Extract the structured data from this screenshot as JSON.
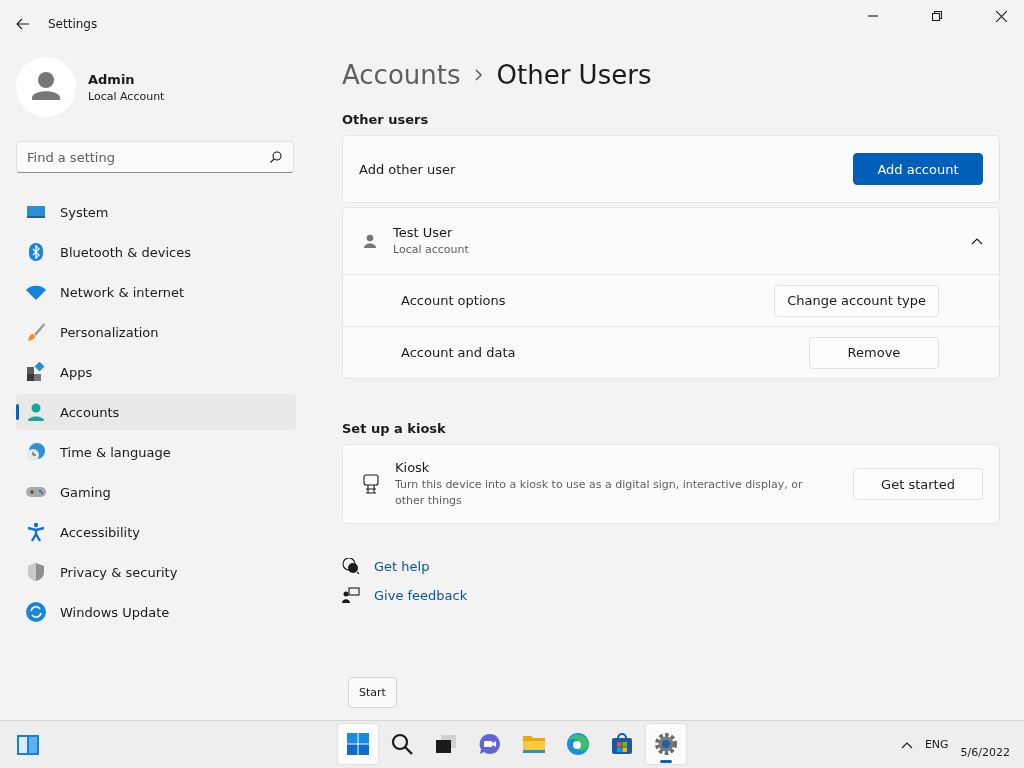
{
  "window": {
    "title": "Settings"
  },
  "profile": {
    "name": "Admin",
    "subtitle": "Local Account"
  },
  "search": {
    "placeholder": "Find a setting"
  },
  "sidebar": {
    "items": [
      {
        "kind": "system",
        "label": "System",
        "selected": false
      },
      {
        "kind": "bluetooth",
        "label": "Bluetooth & devices",
        "selected": false
      },
      {
        "kind": "network",
        "label": "Network & internet",
        "selected": false
      },
      {
        "kind": "personalization",
        "label": "Personalization",
        "selected": false
      },
      {
        "kind": "apps",
        "label": "Apps",
        "selected": false
      },
      {
        "kind": "accounts",
        "label": "Accounts",
        "selected": true
      },
      {
        "kind": "time",
        "label": "Time & language",
        "selected": false
      },
      {
        "kind": "gaming",
        "label": "Gaming",
        "selected": false
      },
      {
        "kind": "accessibility",
        "label": "Accessibility",
        "selected": false
      },
      {
        "kind": "privacy",
        "label": "Privacy & security",
        "selected": false
      },
      {
        "kind": "update",
        "label": "Windows Update",
        "selected": false
      }
    ]
  },
  "breadcrumb": {
    "parent": "Accounts",
    "current": "Other Users"
  },
  "other_users": {
    "heading": "Other users",
    "add_row": {
      "label": "Add other user",
      "button": "Add account"
    },
    "users": [
      {
        "name": "Test User",
        "subtitle": "Local account",
        "expanded": true,
        "options": [
          {
            "label": "Account options",
            "button": "Change account type"
          },
          {
            "label": "Account and data",
            "button": "Remove"
          }
        ]
      }
    ]
  },
  "kiosk": {
    "heading": "Set up a kiosk",
    "title": "Kiosk",
    "description": "Turn this device into a kiosk to use as a digital sign, interactive display, or other things",
    "button": "Get started"
  },
  "links": [
    {
      "kind": "help",
      "label": "Get help"
    },
    {
      "kind": "feedback",
      "label": "Give feedback"
    }
  ],
  "tooltip": {
    "text": "Start"
  },
  "taskbar": {
    "apps": [
      {
        "kind": "start",
        "hovered": true,
        "active": false
      },
      {
        "kind": "search",
        "hovered": false,
        "active": false
      },
      {
        "kind": "taskview",
        "hovered": false,
        "active": false
      },
      {
        "kind": "chat",
        "hovered": false,
        "active": false
      },
      {
        "kind": "explorer",
        "hovered": false,
        "active": false
      },
      {
        "kind": "edge",
        "hovered": false,
        "active": false
      },
      {
        "kind": "store",
        "hovered": false,
        "active": false
      },
      {
        "kind": "settings",
        "hovered": false,
        "active": true
      }
    ],
    "language": "ENG",
    "date": "5/6/2022"
  }
}
